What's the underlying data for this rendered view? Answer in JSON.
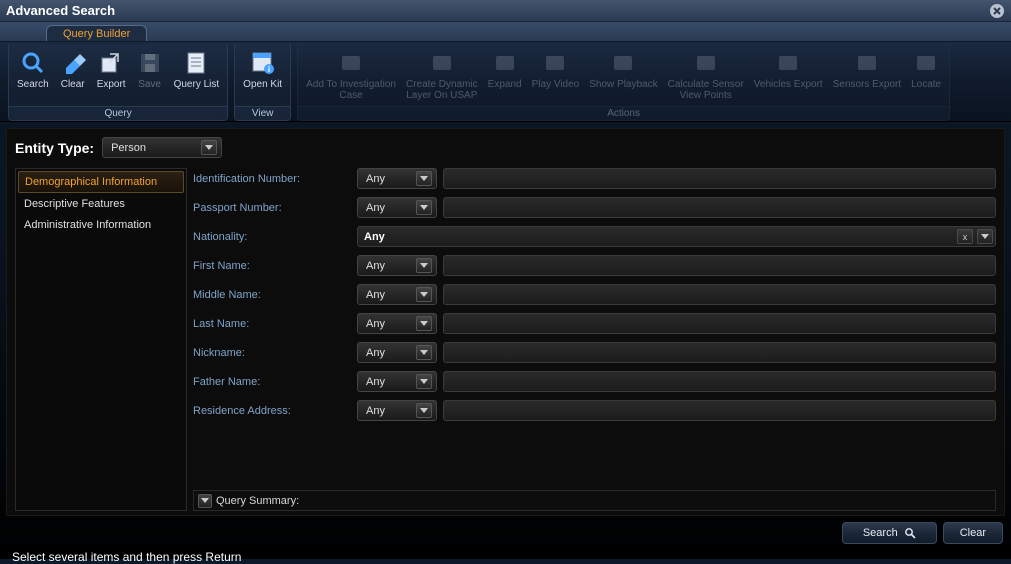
{
  "window": {
    "title": "Advanced Search"
  },
  "tab": {
    "label": "Query Builder"
  },
  "ribbon": {
    "groups": [
      {
        "label": "Query",
        "items": [
          {
            "label": "Search",
            "icon": "search-icon"
          },
          {
            "label": "Clear",
            "icon": "eraser-icon"
          },
          {
            "label": "Export",
            "icon": "export-icon"
          },
          {
            "label": "Save",
            "icon": "save-icon",
            "disabled": true
          },
          {
            "label": "Query List",
            "icon": "query-list-icon"
          }
        ]
      },
      {
        "label": "View",
        "items": [
          {
            "label": "Open Kit",
            "icon": "open-kit-icon"
          }
        ]
      },
      {
        "label": "Actions",
        "disabled": true,
        "items": [
          {
            "label": "Add To Investigation\nCase",
            "icon": "briefcase-icon"
          },
          {
            "label": "Create Dynamic\nLayer On USAP",
            "icon": "layer-icon"
          },
          {
            "label": "Expand",
            "icon": "expand-icon"
          },
          {
            "label": "Play Video",
            "icon": "play-video-icon"
          },
          {
            "label": "Show Playback",
            "icon": "playback-icon"
          },
          {
            "label": "Calculate Sensor\nView Points",
            "icon": "sensor-icon"
          },
          {
            "label": "Vehicles Export",
            "icon": "vehicles-icon"
          },
          {
            "label": "Sensors Export",
            "icon": "sensors-icon"
          },
          {
            "label": "Locate",
            "icon": "locate-icon"
          }
        ]
      }
    ]
  },
  "entity": {
    "label": "Entity Type:",
    "value": "Person"
  },
  "sideTabs": [
    {
      "label": "Demographical Information",
      "active": true
    },
    {
      "label": "Descriptive Features"
    },
    {
      "label": "Administrative Information"
    }
  ],
  "operator_default": "Any",
  "fields": [
    {
      "label": "Identification Number:",
      "operator": "Any"
    },
    {
      "label": "Passport Number:",
      "operator": "Any"
    },
    {
      "label": "Nationality:",
      "value": "Any",
      "special": "nationality"
    },
    {
      "label": "First Name:",
      "operator": "Any"
    },
    {
      "label": "Middle Name:",
      "operator": "Any"
    },
    {
      "label": "Last Name:",
      "operator": "Any"
    },
    {
      "label": "Nickname:",
      "operator": "Any"
    },
    {
      "label": "Father Name:",
      "operator": "Any"
    },
    {
      "label": "Residence Address:",
      "operator": "Any"
    }
  ],
  "querySummary": {
    "label": "Query Summary:"
  },
  "buttons": {
    "search": "Search",
    "clear": "Clear"
  },
  "status": "Select several items and then press Return"
}
